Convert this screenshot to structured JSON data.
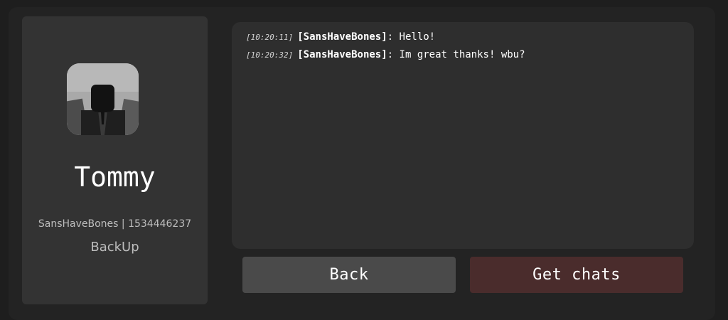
{
  "profile": {
    "display_name": "Tommy",
    "info": "SansHaveBones | 1534446237",
    "status": "BackUp"
  },
  "chat": {
    "messages": [
      {
        "time": "[10:20:11]",
        "user": "[SansHaveBones]",
        "text": ": Hello!"
      },
      {
        "time": "[10:20:32]",
        "user": "[SansHaveBones]",
        "text": ": Im great thanks! wbu?"
      }
    ]
  },
  "actions": {
    "back_label": "Back",
    "get_chats_label": "Get chats"
  },
  "colors": {
    "background": "#1e1e1e",
    "card": "#333333",
    "chat_panel": "#2e2e2e",
    "back_button": "#4a4a4a",
    "get_chats_button": "#4a2c2c"
  }
}
